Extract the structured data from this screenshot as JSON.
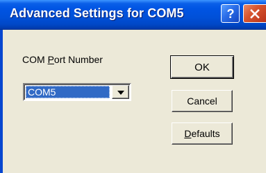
{
  "window": {
    "title": "Advanced Settings for COM5",
    "help_glyph": "?",
    "close_glyph": "×"
  },
  "form": {
    "port_label_prefix": "COM ",
    "port_label_accel": "P",
    "port_label_suffix": "ort Number",
    "port_value": "COM5"
  },
  "buttons": {
    "ok": "OK",
    "cancel": "Cancel",
    "defaults_accel": "D",
    "defaults_rest": "efaults"
  },
  "colors": {
    "titlebar": "#0054e3",
    "face": "#ece9d8",
    "selection": "#316ac5",
    "close": "#d8552e"
  },
  "icons": [
    "help-icon",
    "close-icon",
    "dropdown-arrow-icon"
  ]
}
